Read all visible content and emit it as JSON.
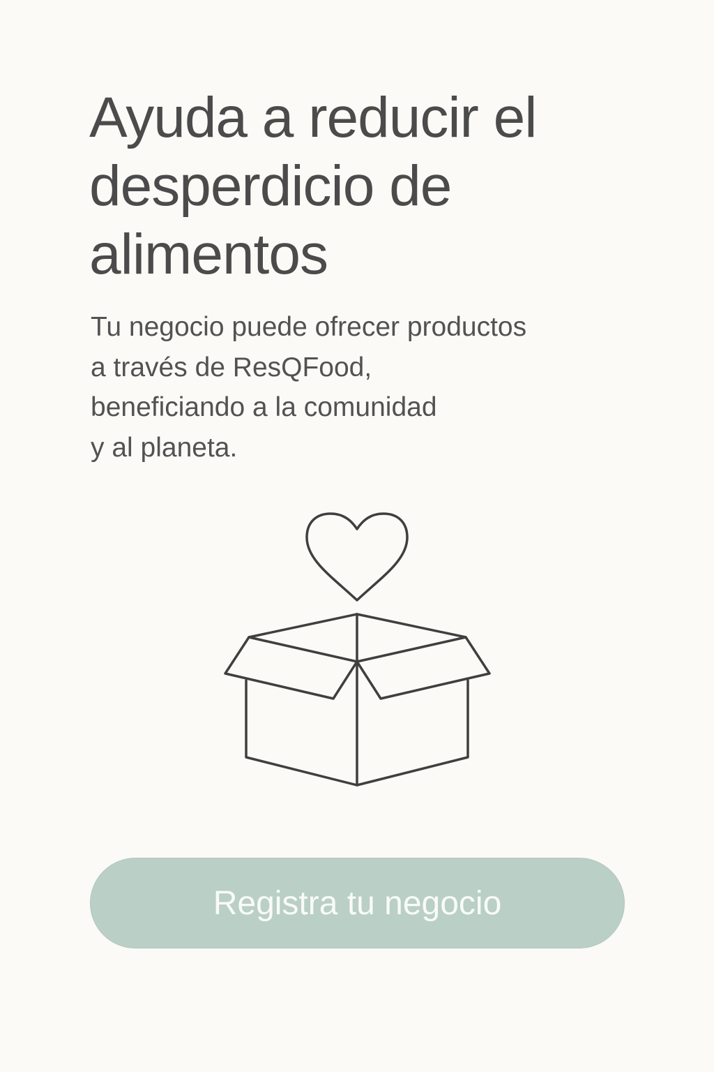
{
  "colors": {
    "background": "#fbfaf6",
    "text": "#4b4b4b",
    "illustration_stroke": "#3f3f3f",
    "button_background": "#bacfc5",
    "button_text": "#f8fbf9"
  },
  "hero": {
    "title_lines": [
      "Ayuda a reducir el",
      "desperdicio de",
      "alimentos"
    ],
    "description_lines": [
      "Tu negocio puede ofrecer productos",
      "a través de ResQFood,",
      "beneficiando a la comunidad",
      "y al planeta."
    ]
  },
  "illustration": {
    "icons": [
      "heart-icon",
      "open-box-icon"
    ]
  },
  "cta": {
    "label": "Registra tu negocio"
  }
}
